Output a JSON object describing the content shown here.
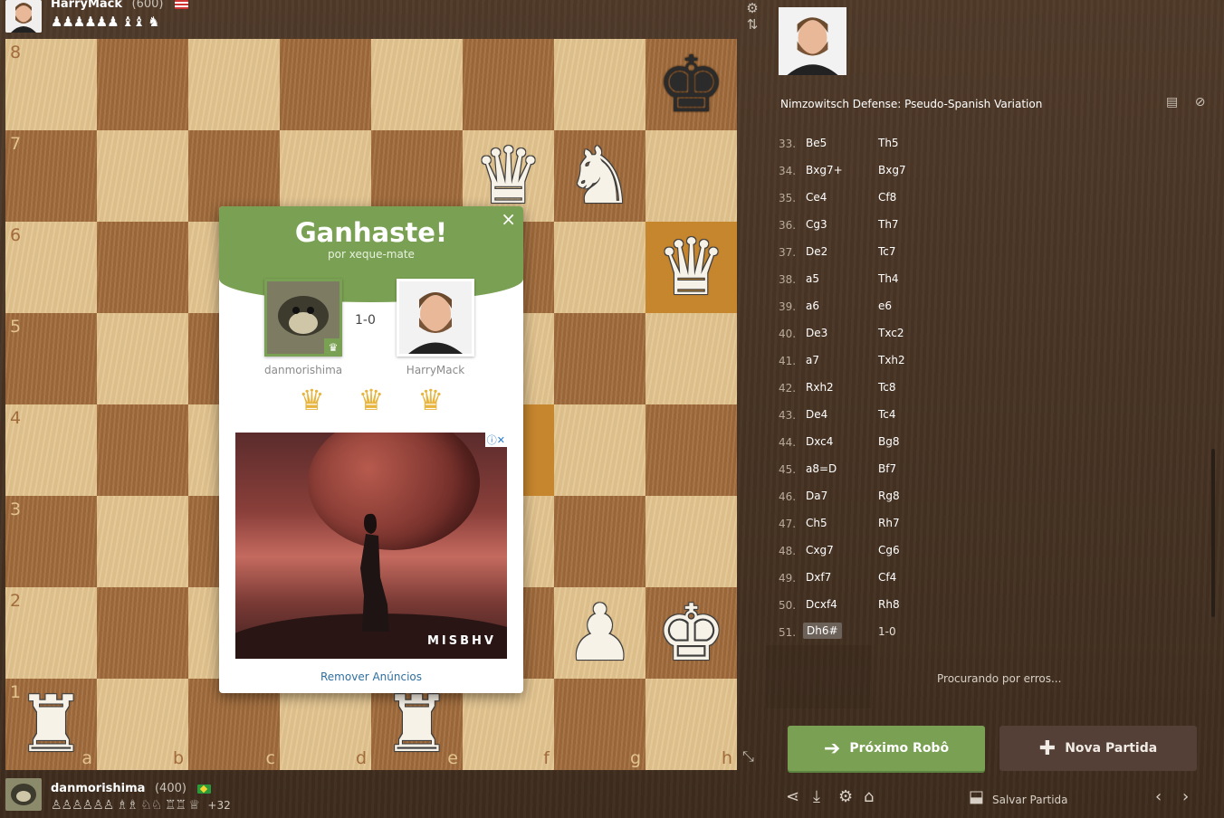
{
  "top_player": {
    "name": "HarryMack",
    "rating": "(600)",
    "captured": "♟♟♟♟♟♟ ♝♝ ♞"
  },
  "bottom_player": {
    "name": "danmorishima",
    "rating": "(400)",
    "captured": "♙♙♙♙♙♙ ♗♗ ♘♘ ♖♖ ♕",
    "material_diff": "+32"
  },
  "board": {
    "rank_labels": [
      "8",
      "7",
      "6",
      "5",
      "4",
      "3",
      "2",
      "1"
    ],
    "file_labels": [
      "a",
      "b",
      "c",
      "d",
      "e",
      "f",
      "g",
      "h"
    ]
  },
  "modal": {
    "title": "Ganhaste!",
    "subtitle": "por xeque-mate",
    "close": "×",
    "winner_name": "danmorishima",
    "loser_name": "HarryMack",
    "score": "1-0",
    "crown_icon": "♛",
    "ad_brand": "MISBHV",
    "ad_choices": "ⓘ✕",
    "remove_ads": "Remover Anúncios"
  },
  "sidebar": {
    "opening": "Nimzowitsch Defense: Pseudo-Spanish Variation",
    "moves": [
      {
        "n": "33.",
        "w": "Be5",
        "b": "Th5"
      },
      {
        "n": "34.",
        "w": "Bxg7+",
        "b": "Bxg7"
      },
      {
        "n": "35.",
        "w": "Ce4",
        "b": "Cf8"
      },
      {
        "n": "36.",
        "w": "Cg3",
        "b": "Th7"
      },
      {
        "n": "37.",
        "w": "De2",
        "b": "Tc7"
      },
      {
        "n": "38.",
        "w": "a5",
        "b": "Th4"
      },
      {
        "n": "39.",
        "w": "a6",
        "b": "e6"
      },
      {
        "n": "40.",
        "w": "De3",
        "b": "Txc2"
      },
      {
        "n": "41.",
        "w": "a7",
        "b": "Txh2"
      },
      {
        "n": "42.",
        "w": "Rxh2",
        "b": "Tc8"
      },
      {
        "n": "43.",
        "w": "De4",
        "b": "Tc4"
      },
      {
        "n": "44.",
        "w": "Dxc4",
        "b": "Bg8"
      },
      {
        "n": "45.",
        "w": "a8=D",
        "b": "Bf7"
      },
      {
        "n": "46.",
        "w": "Da7",
        "b": "Rg8"
      },
      {
        "n": "47.",
        "w": "Ch5",
        "b": "Rh7"
      },
      {
        "n": "48.",
        "w": "Cxg7",
        "b": "Cg6"
      },
      {
        "n": "49.",
        "w": "Dxf7",
        "b": "Cf4"
      },
      {
        "n": "50.",
        "w": "Dcxf4",
        "b": "Rh8"
      },
      {
        "n": "51.",
        "w": "Dh6#",
        "b": "1-0"
      }
    ],
    "analysis_status": "Procurando por erros...",
    "next_bot_label": "Próximo Robô",
    "new_game_label": "Nova Partida",
    "save_game_label": "Salvar Partida"
  },
  "colors": {
    "accent_green": "#7aa153",
    "board_light": "#e3c48f",
    "board_dark": "#a26c3c",
    "highlight": "#e8b45a"
  }
}
